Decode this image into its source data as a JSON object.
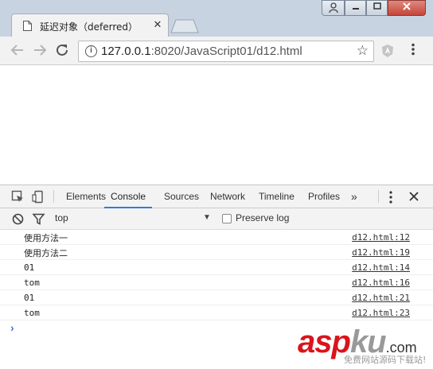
{
  "browser": {
    "tab_title": "延迟对象（deferred）",
    "tab_close": "✕",
    "url_host": "127.0.0.1",
    "url_rest": ":8020/JavaScript01/d12.html"
  },
  "devtools": {
    "tabs": [
      {
        "label": "Elements"
      },
      {
        "label": "Console",
        "active": true
      },
      {
        "label": "Sources"
      },
      {
        "label": "Network"
      },
      {
        "label": "Timeline"
      },
      {
        "label": "Profiles"
      }
    ],
    "more": "»",
    "filter": {
      "context": "top",
      "preserve_log_label": "Preserve log"
    },
    "console": [
      {
        "text": "使用方法一",
        "source": "d12.html:12"
      },
      {
        "text": "使用方法二",
        "source": "d12.html:19"
      },
      {
        "text": "01",
        "source": "d12.html:14"
      },
      {
        "text": "tom",
        "source": "d12.html:16"
      },
      {
        "text": "01",
        "source": "d12.html:21"
      },
      {
        "text": "tom",
        "source": "d12.html:23"
      }
    ],
    "prompt": "›"
  },
  "watermark": {
    "logo": "asp",
    "logo_mid": "ku",
    "logo_tld": ".com",
    "subtitle": "免费网站源码下载站!"
  },
  "colors": {
    "accent": "#3879d9",
    "watermark_red": "#d8151b"
  }
}
